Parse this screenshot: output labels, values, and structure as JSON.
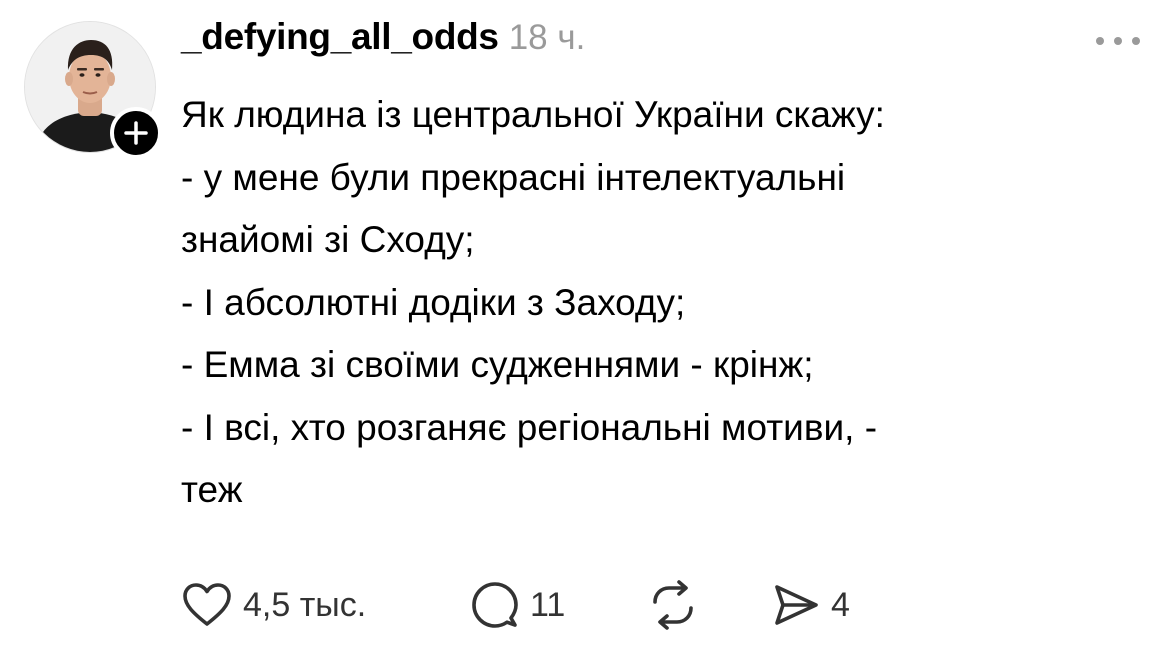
{
  "post": {
    "username": "_defying_all_odds",
    "timestamp": "18 ч.",
    "lines": [
      "Як людина із центральної України скажу:",
      "- у мене були прекрасні інтелектуальні",
      "знайомі зі Сходу;",
      "- І абсолютні додіки з Заходу;",
      "- Емма зі своїми судженнями - крінж;",
      "- І всі, хто розганяє регіональні мотиви, -",
      "теж"
    ]
  },
  "actions": {
    "likes": "4,5 тыс.",
    "comments": "11",
    "shares": "4"
  },
  "icons": {
    "avatar": "profile-photo",
    "follow": "plus-icon",
    "more": "ellipsis-icon",
    "like": "heart-icon",
    "comment": "speech-bubble-icon",
    "repost": "repost-arrows-icon",
    "share": "send-arrow-icon"
  },
  "colors": {
    "text": "#000000",
    "muted": "#9a9a9a",
    "count": "#333333",
    "badge": "#000000"
  }
}
